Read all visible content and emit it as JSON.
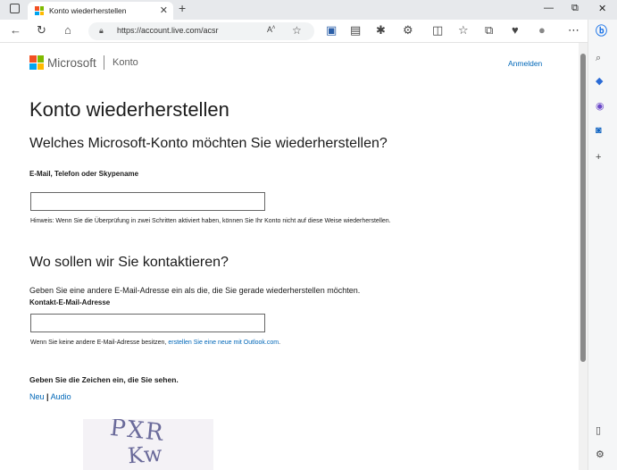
{
  "browser": {
    "tab_title": "Konto wiederherstellen",
    "new_tab_symbol": "+",
    "close_symbol": "✕",
    "url": "https://account.live.com/acsr",
    "window": {
      "minimize": "—",
      "maximize": "⧉",
      "close": "✕"
    }
  },
  "header": {
    "brand": "Microsoft",
    "section": "Konto",
    "signin": "Anmelden"
  },
  "page": {
    "title": "Konto wiederherstellen",
    "question_account": "Welches Microsoft-Konto möchten Sie wiederherstellen?",
    "account_label": "E-Mail, Telefon oder Skypename",
    "account_value": "",
    "hint": "Hinweis: Wenn Sie die Überprüfung in zwei Schritten aktiviert haben, können Sie Ihr Konto nicht auf diese Weise wiederherstellen.",
    "question_contact": "Wo sollen wir Sie kontaktieren?",
    "contact_instruction": "Geben Sie eine andere E-Mail-Adresse ein als die, die Sie gerade wiederherstellen möchten.",
    "contact_label": "Kontakt-E-Mail-Adresse",
    "contact_value": "",
    "no_email_prefix": "Wenn Sie keine andere E-Mail-Adresse besitzen, ",
    "no_email_link": "erstellen Sie eine neue mit Outlook.com",
    "no_email_suffix": ".",
    "captcha_label": "Geben Sie die Zeichen ein, die Sie sehen.",
    "captcha_new": "Neu",
    "captcha_sep": "|",
    "captcha_audio": "Audio",
    "captcha_line1": "PXR",
    "captcha_line2": "Kw"
  },
  "colors": {
    "ms_red": "#f25022",
    "ms_green": "#7fba00",
    "ms_blue": "#00a4ef",
    "ms_yellow": "#ffb900",
    "link": "#0067b8"
  }
}
